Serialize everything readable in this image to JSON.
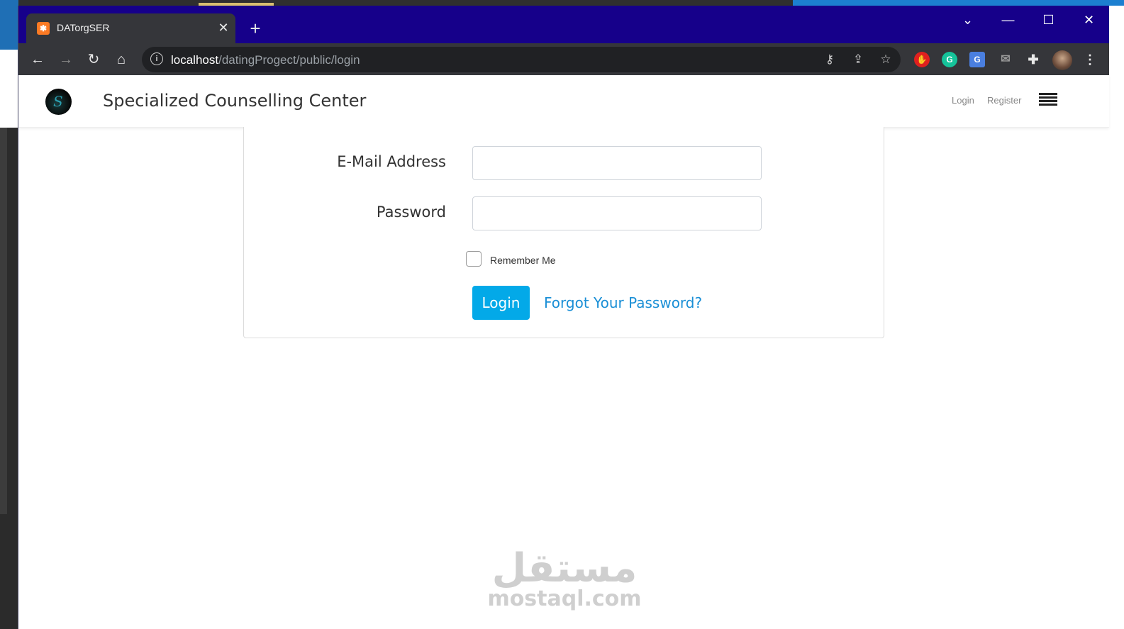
{
  "browser": {
    "tab_title": "DATorgSER",
    "tab_favicon": "xampp-icon",
    "url_host": "localhost",
    "url_path": "/datingProgect/public/login",
    "window_controls": {
      "dropdown": "⌄",
      "minimize": "—",
      "maximize": "☐",
      "close": "✕"
    }
  },
  "navbar": {
    "brand": "Specialized Counselling Center",
    "links": {
      "login": "Login",
      "register": "Register"
    }
  },
  "form": {
    "email_label": "E-Mail Address",
    "email_value": "",
    "password_label": "Password",
    "password_value": "",
    "remember_label": "Remember Me",
    "remember_checked": false,
    "login_button": "Login",
    "forgot_link": "Forgot Your Password?"
  },
  "watermark": {
    "arabic": "مستقل",
    "latin": "mostaql.com"
  },
  "colors": {
    "titlebar": "#16008a",
    "toolbar": "#35363a",
    "primary_button": "#03a9e8",
    "link": "#1a8fd6"
  }
}
